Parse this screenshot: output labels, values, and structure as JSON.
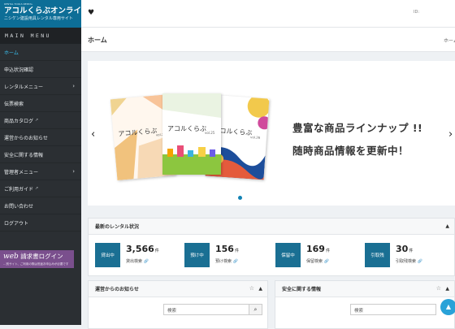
{
  "brand": {
    "tagline": "RENTAL TOOLS RENTAL",
    "name": "アコルくらぶオンライン",
    "subtitle": "ニシケン建設用具レンタル専用サイト"
  },
  "sidebar": {
    "menu_heading": "MAIN MENU",
    "items": [
      {
        "label": "ホーム",
        "active": true
      },
      {
        "label": "申込状況確認"
      },
      {
        "label": "レンタルメニュー",
        "chevron": true
      },
      {
        "label": "伝票検索"
      },
      {
        "label": "商品カタログ",
        "external": true
      },
      {
        "label": "運営からのお知らせ"
      },
      {
        "label": "安全に関する情報"
      },
      {
        "label": "管理者メニュー",
        "chevron": true
      },
      {
        "label": "ご利用ガイド",
        "external": true
      },
      {
        "label": "お問い合わせ"
      },
      {
        "label": "ログアウト"
      }
    ],
    "web_invoice": {
      "label_web": "web",
      "label": "請求書ログイン",
      "note": "…別サイト、ご利用の際は別途お申込みが必要です"
    }
  },
  "topbar": {
    "icon": "heart-icon",
    "user_id": "ID:"
  },
  "page": {
    "title": "ホーム",
    "breadcrumb": "ホーム"
  },
  "carousel": {
    "promo_line1": "豊富な商品ラインナップ !!",
    "promo_line2": "随時商品情報を更新中！",
    "catalogs": [
      {
        "title": "アコルくらぶ",
        "vol": "vol.24"
      },
      {
        "title": "アコルくらぶ",
        "vol": "vol.25"
      },
      {
        "title": "アコルくらぶ",
        "vol": "vol.26"
      }
    ]
  },
  "rental_status": {
    "title": "最新のレンタル状況",
    "stats": [
      {
        "badge": "貸出中",
        "count": "3,566",
        "unit": "件",
        "link": "貸出検索"
      },
      {
        "badge": "預け中",
        "count": "156",
        "unit": "件",
        "link": "預け検索"
      },
      {
        "badge": "保留中",
        "count": "169",
        "unit": "件",
        "link": "保留検索"
      },
      {
        "badge": "引取残",
        "count": "30",
        "unit": "件",
        "link": "引取残検索"
      }
    ]
  },
  "notices": {
    "title": "運営からのお知らせ",
    "search_placeholder": "検索"
  },
  "safety": {
    "title": "安全に関する情報",
    "search_placeholder": "検索"
  },
  "colors": {
    "brand": "#0d6e97",
    "sidebar": "#2b2f33",
    "active": "#39c0ef",
    "badge": "#1a6f93",
    "web_button": "#7a4f8d"
  }
}
